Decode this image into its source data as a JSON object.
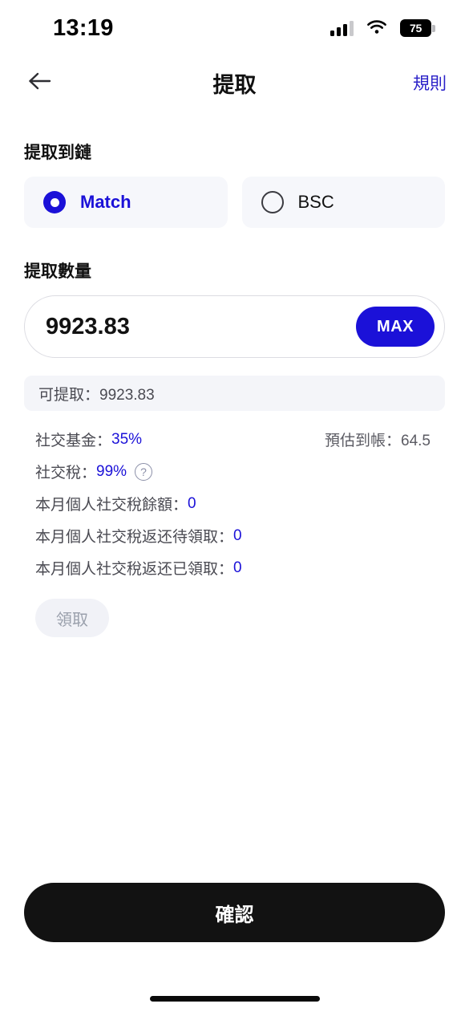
{
  "status_bar": {
    "time": "13:19",
    "signal_icon": "cellular-signal-icon",
    "wifi_icon": "wifi-icon",
    "battery_level": "75"
  },
  "nav": {
    "back_icon": "back-arrow-icon",
    "title": "提取",
    "action_label": "規則"
  },
  "chain_section": {
    "label": "提取到鏈",
    "options": [
      {
        "label": "Match",
        "selected": true
      },
      {
        "label": "BSC",
        "selected": false
      }
    ]
  },
  "amount_section": {
    "label": "提取數量",
    "value": "9923.83",
    "placeholder": "0.00",
    "max_label": "MAX"
  },
  "available": {
    "text": "可提取：9923.83"
  },
  "info": {
    "fund_label": "社交基金：",
    "fund_value": "35%",
    "estimate_text": "預估到帳：64.5",
    "tax_label": "社交稅：",
    "tax_value": "99%",
    "help_icon": "question-mark-icon",
    "balance_label": "本月個人社交稅餘額：",
    "balance_value": "0",
    "pending_label": "本月個人社交稅返还待領取：",
    "pending_value": "0",
    "claimed_label": "本月個人社交稅返还已領取：",
    "claimed_value": "0"
  },
  "claim_button": {
    "label": "領取",
    "disabled": true
  },
  "confirm_button": {
    "label": "確認"
  },
  "colors": {
    "accent_blue": "#1b11d8",
    "link_blue": "#2a20c8",
    "confirm_black": "#121212",
    "disabled_gray": "#9aa0ac",
    "panel_gray": "#f6f7fb"
  }
}
